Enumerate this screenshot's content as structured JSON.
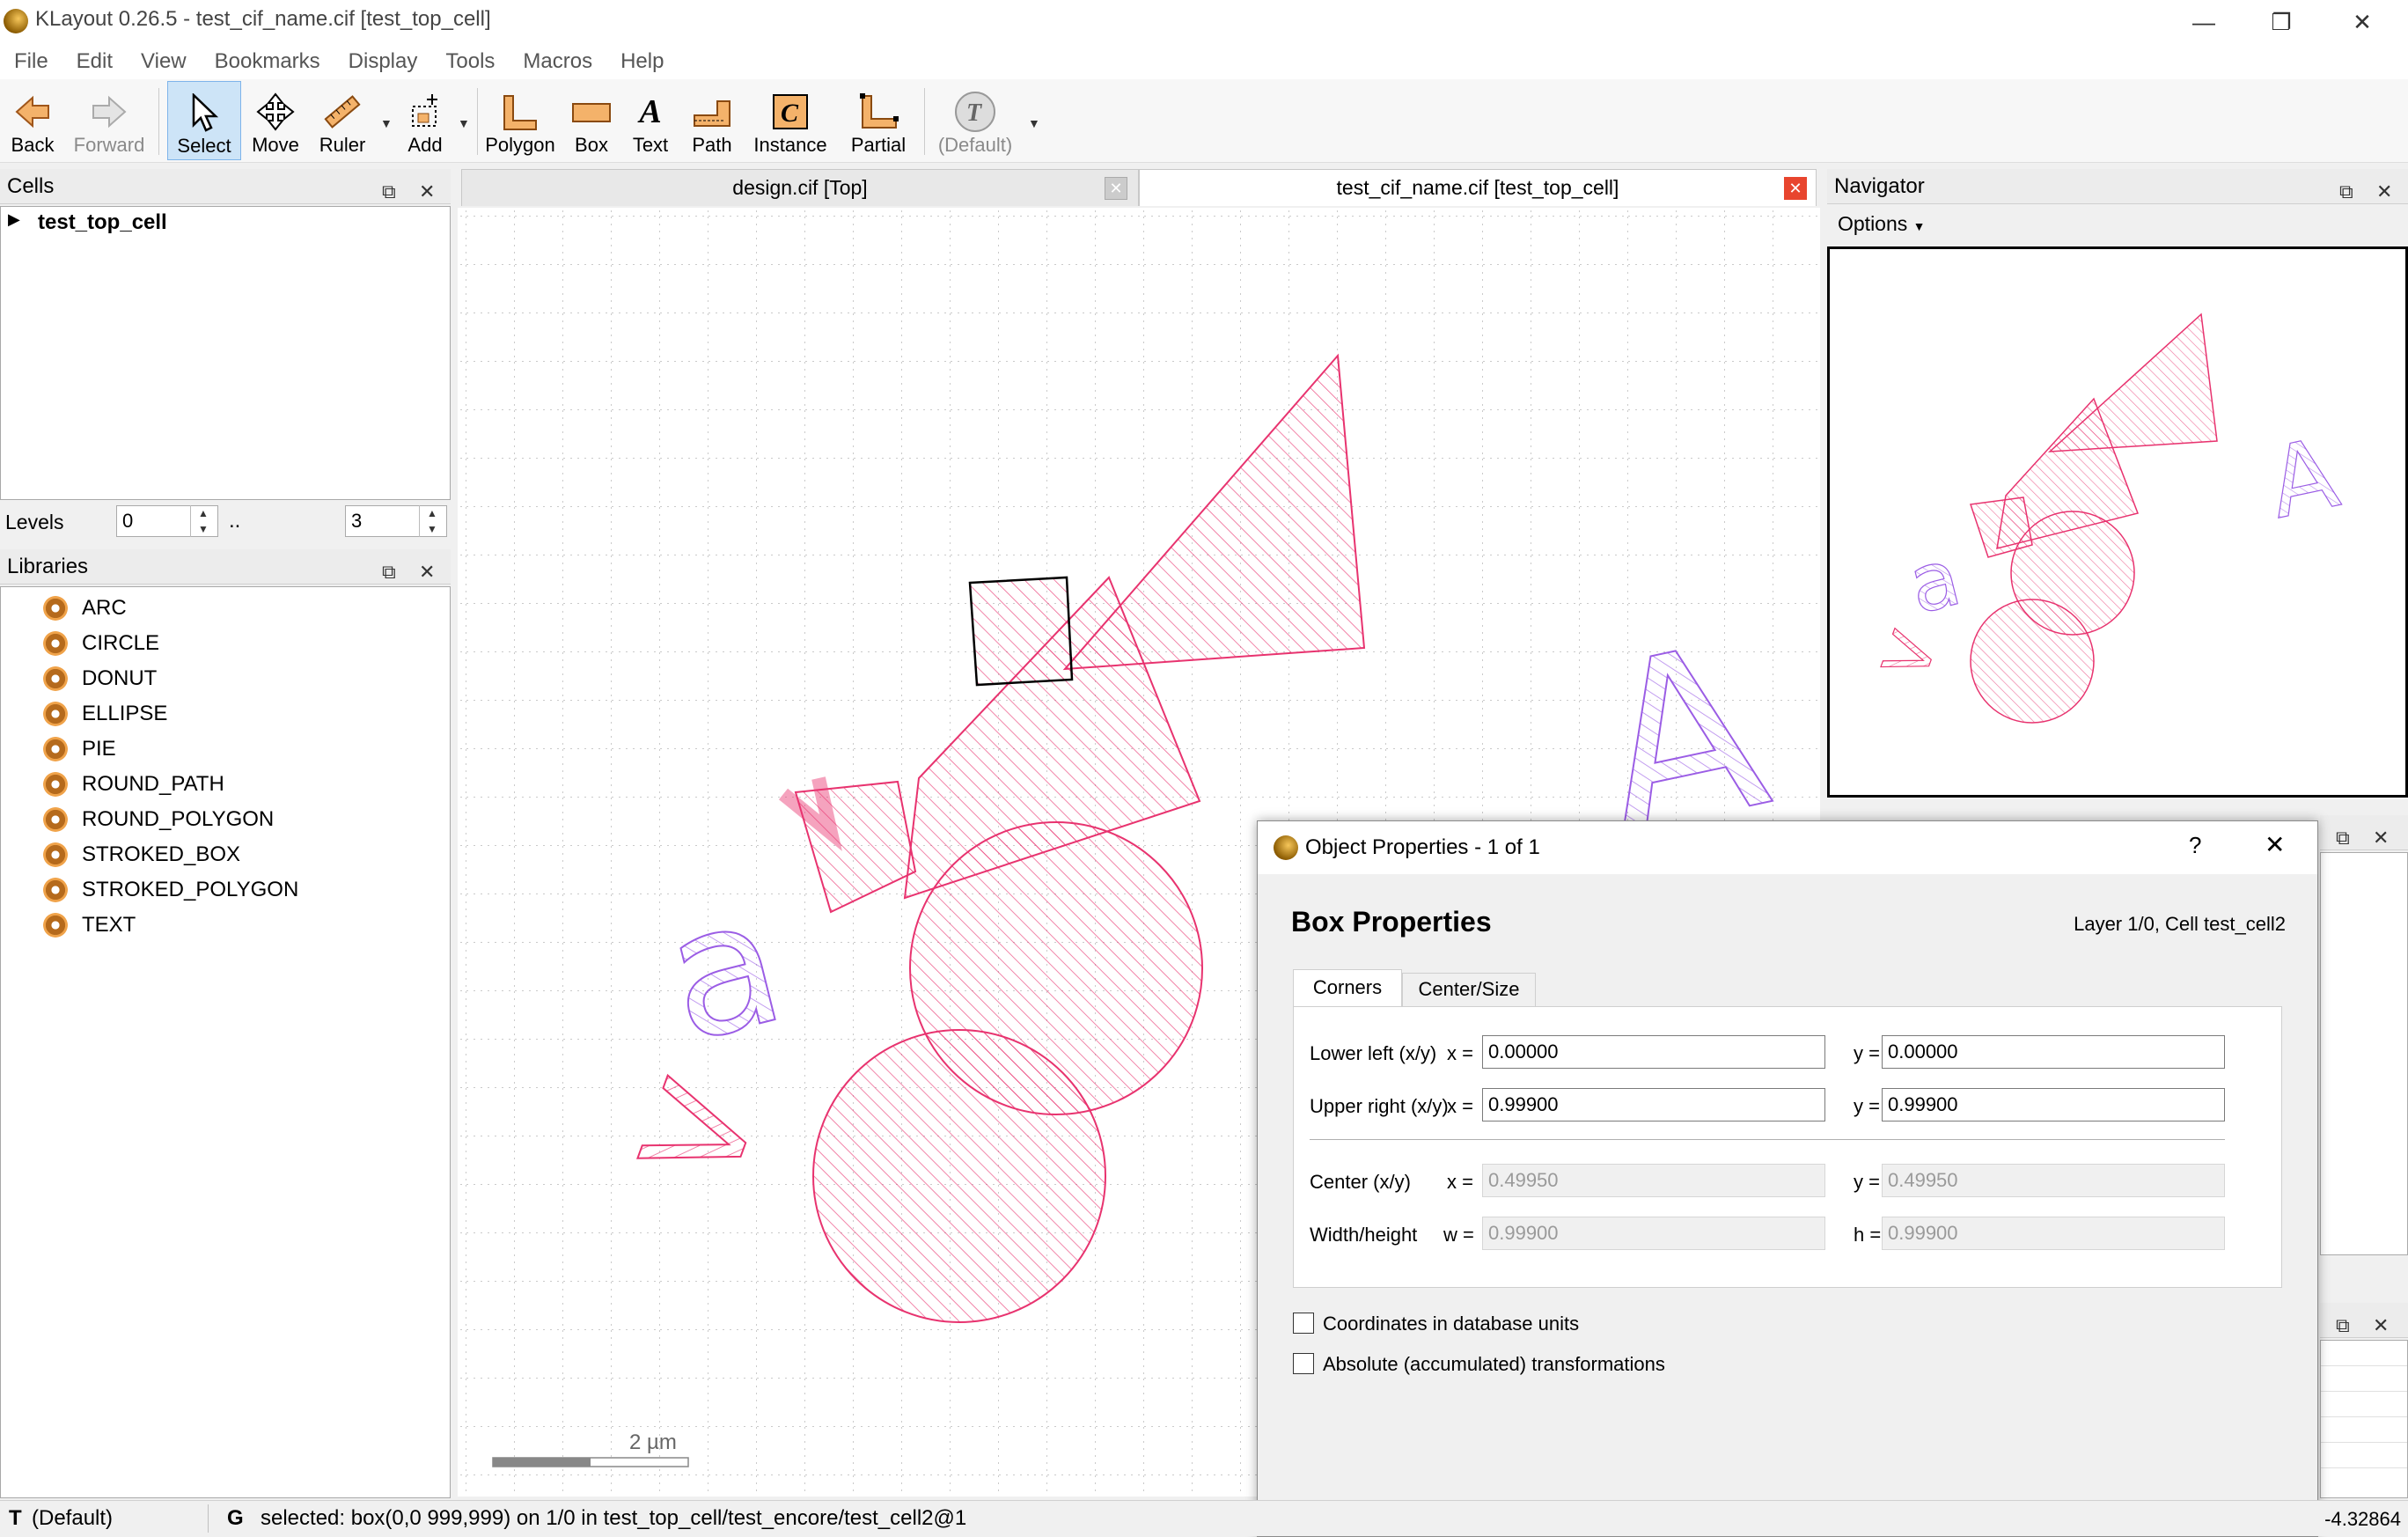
{
  "window": {
    "title": "KLayout 0.26.5 - test_cif_name.cif [test_top_cell]",
    "minimize_glyph": "—",
    "restore_glyph": "❐",
    "close_glyph": "✕"
  },
  "menu": [
    "File",
    "Edit",
    "View",
    "Bookmarks",
    "Display",
    "Tools",
    "Macros",
    "Help"
  ],
  "toolbar": {
    "back": "Back",
    "forward": "Forward",
    "select": "Select",
    "move": "Move",
    "ruler": "Ruler",
    "add": "Add",
    "polygon": "Polygon",
    "box": "Box",
    "text": "Text",
    "path": "Path",
    "instance": "Instance",
    "partial": "Partial",
    "default": "(Default)"
  },
  "cells_panel": {
    "title": "Cells",
    "top_cell": "test_top_cell",
    "levels_label": "Levels",
    "level_from": "0",
    "level_sep": "..",
    "level_to": "3"
  },
  "libraries_panel": {
    "title": "Libraries",
    "items": [
      "ARC",
      "CIRCLE",
      "DONUT",
      "ELLIPSE",
      "PIE",
      "ROUND_PATH",
      "ROUND_POLYGON",
      "STROKED_BOX",
      "STROKED_POLYGON",
      "TEXT"
    ]
  },
  "tabs": [
    {
      "label": "design.cif [Top]",
      "active": false
    },
    {
      "label": "test_cif_name.cif [test_top_cell]",
      "active": true
    }
  ],
  "canvas": {
    "scale_label": "2 µm",
    "shape_color": "#e8336f",
    "text_color": "#9b5de5"
  },
  "navigator": {
    "title": "Navigator",
    "options": "Options"
  },
  "dialog": {
    "title": "Object Properties - 1 of 1",
    "help": "?",
    "heading": "Box Properties",
    "layer_info": "Layer 1/0, Cell test_cell2",
    "tabs": [
      "Corners",
      "Center/Size"
    ],
    "lower_left_label": "Lower left (x/y)",
    "upper_right_label": "Upper right (x/y)",
    "center_label": "Center (x/y)",
    "width_height_label": "Width/height",
    "x_eq": "x =",
    "y_eq": "y =",
    "w_eq": "w =",
    "h_eq": "h =",
    "lower_left_x": "0.00000",
    "lower_left_y": "0.00000",
    "upper_right_x": "0.99900",
    "upper_right_y": "0.99900",
    "center_x": "0.49950",
    "center_y": "0.49950",
    "width": "0.99900",
    "height": "0.99900",
    "db_units_label": "Coordinates in database units",
    "abs_trans_label": "Absolute (accumulated) transformations"
  },
  "status": {
    "t_key": "T",
    "t_value": "(Default)",
    "g_key": "G",
    "message": "selected: box(0,0 999,999) on 1/0 in test_top_cell/test_encore/test_cell2@1",
    "coord": "-4.32864"
  }
}
